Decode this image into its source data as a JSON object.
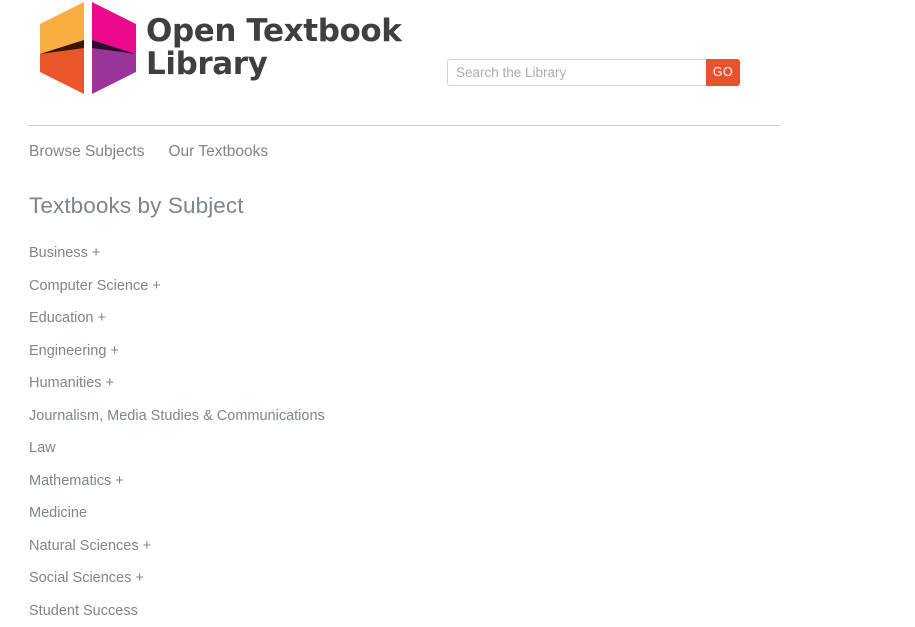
{
  "site": {
    "logo_icon": "open-textbook-library-hexagon-logo",
    "wordmark": "Open Textbook\nLibrary",
    "logo_colors": {
      "top_left": "#F9AE42",
      "top_right": "#EC0A8C",
      "bottom_left": "#E8562A",
      "bottom_right": "#9B3499",
      "shadow_left": "#3A1508",
      "shadow_right": "#2E0A2E",
      "wordmark_text": "#3F3F3F"
    }
  },
  "search": {
    "placeholder": "Search the Library",
    "value": "",
    "go_label": "GO",
    "go_color": "#E8522C",
    "search_icon": "search-icon"
  },
  "nav": {
    "items": [
      {
        "label": "Browse Subjects"
      },
      {
        "label": "Our Textbooks"
      }
    ]
  },
  "main": {
    "title": "Textbooks by Subject",
    "expand_symbol": "+",
    "subjects": [
      {
        "label": "Business",
        "expandable": true
      },
      {
        "label": "Computer Science",
        "expandable": true
      },
      {
        "label": "Education",
        "expandable": true
      },
      {
        "label": "Engineering",
        "expandable": true
      },
      {
        "label": "Humanities",
        "expandable": true
      },
      {
        "label": "Journalism, Media Studies & Communications",
        "expandable": false
      },
      {
        "label": "Law",
        "expandable": false
      },
      {
        "label": "Mathematics",
        "expandable": true
      },
      {
        "label": "Medicine",
        "expandable": false
      },
      {
        "label": "Natural Sciences",
        "expandable": true
      },
      {
        "label": "Social Sciences",
        "expandable": true
      },
      {
        "label": "Student Success",
        "expandable": false
      }
    ]
  },
  "theme": {
    "text_gray": "#7E858C",
    "divider": "#C9C9C9",
    "background": "#FFFFFF"
  }
}
